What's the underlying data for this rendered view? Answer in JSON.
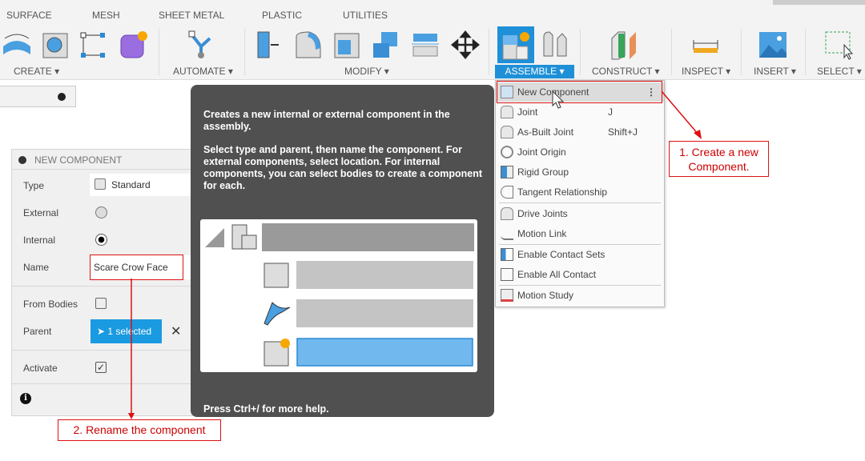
{
  "toolbar": {
    "tabs": [
      "SURFACE",
      "MESH",
      "SHEET METAL",
      "PLASTIC",
      "UTILITIES"
    ],
    "groups": {
      "create": "CREATE ▾",
      "automate": "AUTOMATE ▾",
      "modify": "MODIFY ▾",
      "assemble": "ASSEMBLE ▾",
      "construct": "CONSTRUCT ▾",
      "inspect": "INSPECT ▾",
      "insert": "INSERT ▾",
      "select": "SELECT ▾"
    },
    "accent": "#1e90d8"
  },
  "panel": {
    "title": "NEW COMPONENT",
    "type_label": "Type",
    "type_value": "Standard",
    "external_label": "External",
    "external_checked": false,
    "internal_label": "Internal",
    "internal_checked": true,
    "name_label": "Name",
    "name_value": "Scare Crow Face",
    "from_bodies_label": "From Bodies",
    "from_bodies_checked": false,
    "parent_label": "Parent",
    "parent_value": "1 selected",
    "activate_label": "Activate",
    "activate_checked": true
  },
  "tooltip": {
    "p1": "Creates a new internal or external component in the assembly.",
    "p2": "Select type and parent, then name the component. For external components, select location. For internal components, you can select bodies to create a component for each.",
    "footer": "Press Ctrl+/ for more help."
  },
  "menu": {
    "items": [
      {
        "label": "New Component",
        "shortcut": ""
      },
      {
        "label": "Joint",
        "shortcut": "J"
      },
      {
        "label": "As-Built Joint",
        "shortcut": "Shift+J"
      },
      {
        "label": "Joint Origin",
        "shortcut": ""
      },
      {
        "label": "Rigid Group",
        "shortcut": ""
      },
      {
        "label": "Tangent Relationship",
        "shortcut": ""
      },
      {
        "label": "Drive Joints",
        "shortcut": ""
      },
      {
        "label": "Motion Link",
        "shortcut": ""
      },
      {
        "label": "Enable Contact Sets",
        "shortcut": ""
      },
      {
        "label": "Enable All Contact",
        "shortcut": ""
      },
      {
        "label": "Motion Study",
        "shortcut": ""
      }
    ]
  },
  "annotations": {
    "step1": "1. Create a new Component.",
    "step2": "2. Rename the component",
    "color": "#d11111"
  }
}
